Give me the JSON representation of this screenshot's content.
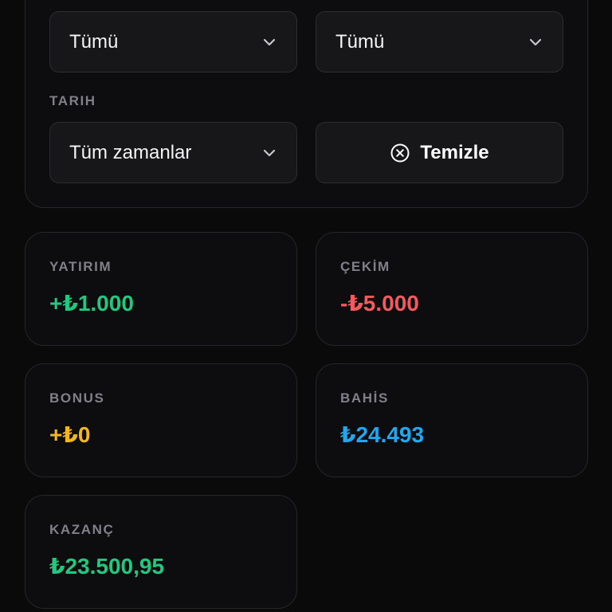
{
  "filters": {
    "select_1": {
      "value": "Tümü",
      "icon": "chevron-down-icon"
    },
    "select_2": {
      "value": "Tümü",
      "icon": "chevron-down-icon"
    },
    "date_label": "TARIH",
    "date_select": {
      "value": "Tüm zamanlar",
      "icon": "chevron-down-icon"
    },
    "clear_button": {
      "label": "Temizle",
      "icon": "x-circle-icon"
    }
  },
  "stats": {
    "deposit": {
      "label": "YATIRIM",
      "value": "+₺1.000",
      "color": "#22c780"
    },
    "withdrawal": {
      "label": "ÇEKİM",
      "value": "-₺5.000",
      "color": "#f25a5f"
    },
    "bonus": {
      "label": "BONUS",
      "value": "+₺0",
      "color": "#f2b720"
    },
    "bet": {
      "label": "BAHİS",
      "value": "₺24.493",
      "color": "#1fa8ef"
    },
    "winnings": {
      "label": "KAZANÇ",
      "value": "₺23.500,95",
      "color": "#22c780"
    }
  }
}
